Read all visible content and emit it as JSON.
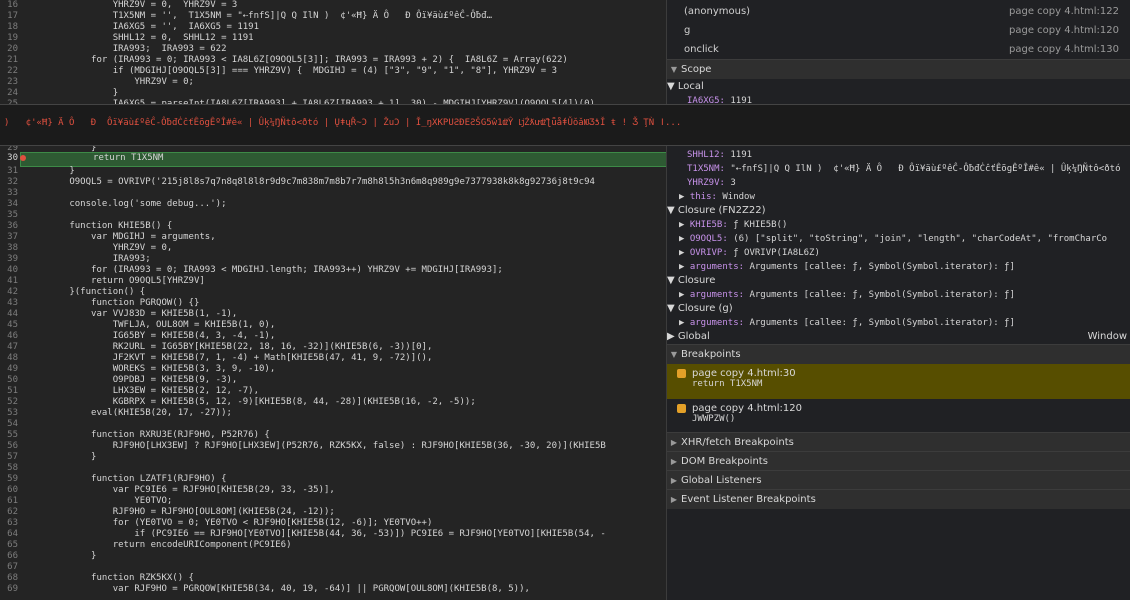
{
  "code_top": [
    {
      "n": "16",
      "t": "                YHRZ9V = 0,  YHRZ9V = 3"
    },
    {
      "n": "17",
      "t": "                T1X5NM = '',  T1X5NM = \"⇠fnfS]|Q Q IlN )  ¢'«Ħ} Ä Ô   Đ Ôï¥äù£ºêĈ-Ôƀđ…"
    },
    {
      "n": "18",
      "t": "                IA6XG5 = '',  IA6XG5 = 1191"
    },
    {
      "n": "19",
      "t": "                SHHL12 = 0,  SHHL12 = 1191"
    },
    {
      "n": "20",
      "t": "                IRA993;  IRA993 = 622"
    },
    {
      "n": "21",
      "t": "            for (IRA993 = 0; IRA993 < IA8L6Z[O9OQL5[3]]; IRA993 = IRA993 + 2) {  IA8L6Z = Array(622)"
    },
    {
      "n": "22",
      "t": "                if (MDGIHJ[O9OQL5[3]] === YHRZ9V) {  MDGIHJ = (4) [\"3\", \"9\", \"1\", \"8\"], YHRZ9V = 3"
    },
    {
      "n": "23",
      "t": "                    YHRZ9V = 0;"
    },
    {
      "n": "24",
      "t": "                }"
    },
    {
      "n": "25",
      "t": "                IA6XG5 = parseInt(IA8L6Z[IRA993] + IA8L6Z[IRA993 + 1], 30) - MDGIHJ[YHRZ9V](O9OQL5[4])(0)"
    }
  ],
  "code_mid": [
    {
      "n": "29",
      "t": "            }"
    }
  ],
  "highlight": {
    "n": "30",
    "t": "            return T1X5NM"
  },
  "code_bottom": [
    {
      "n": "31",
      "t": "        }"
    },
    {
      "n": "32",
      "t": "        O9OQL5 = OVRIVP('215j8l8s7q7n8q8l8l8r9d9c7m838m7m8b7r7m8h8l5h3n6m8q989g9e7377938k8k8g92736j8t9c94"
    },
    {
      "n": "33",
      "t": ""
    },
    {
      "n": "34",
      "t": "        console.log('some debug...');"
    },
    {
      "n": "35",
      "t": ""
    },
    {
      "n": "36",
      "t": "        function KHIE5B() {"
    },
    {
      "n": "37",
      "t": "            var MDGIHJ = arguments,"
    },
    {
      "n": "38",
      "t": "                YHRZ9V = 0,"
    },
    {
      "n": "39",
      "t": "                IRA993;"
    },
    {
      "n": "40",
      "t": "            for (IRA993 = 0; IRA993 < MDGIHJ.length; IRA993++) YHRZ9V += MDGIHJ[IRA993];"
    },
    {
      "n": "41",
      "t": "            return O9OQL5[YHRZ9V]"
    },
    {
      "n": "42",
      "t": "        }(function() {"
    },
    {
      "n": "43",
      "t": "            function PGRQOW() {}"
    },
    {
      "n": "44",
      "t": "            var VVJ83D = KHIE5B(1, -1),"
    },
    {
      "n": "45",
      "t": "                TWFLJA, OUL8OM = KHIE5B(1, 0),"
    },
    {
      "n": "46",
      "t": "                IG65BY = KHIE5B(4, 3, -4, -1),"
    },
    {
      "n": "47",
      "t": "                RK2URL = IG65BY[KHIE5B(22, 18, 16, -32)](KHIE5B(6, -3))[0],"
    },
    {
      "n": "48",
      "t": "                JF2KVT = KHIE5B(7, 1, -4) + Math[KHIE5B(47, 41, 9, -72)](),"
    },
    {
      "n": "49",
      "t": "                WOREKS = KHIE5B(3, 3, 9, -10),"
    },
    {
      "n": "50",
      "t": "                O9PDBJ = KHIE5B(9, -3),"
    },
    {
      "n": "51",
      "t": "                LHX3EW = KHIE5B(2, 12, -7),"
    },
    {
      "n": "52",
      "t": "                KGBRPX = KHIE5B(5, 12, -9)[KHIE5B(8, 44, -28)](KHIE5B(16, -2, -5));"
    },
    {
      "n": "53",
      "t": "            eval(KHIE5B(20, 17, -27));"
    },
    {
      "n": "54",
      "t": ""
    },
    {
      "n": "55",
      "t": "            function RXRU3E(RJF9HO, P52R76) {"
    },
    {
      "n": "56",
      "t": "                RJF9HO[LHX3EW] ? RJF9HO[LHX3EW](P52R76, RZK5KX, false) : RJF9HO[KHIE5B(36, -30, 20)](KHIE5B"
    },
    {
      "n": "57",
      "t": "            }"
    },
    {
      "n": "58",
      "t": ""
    },
    {
      "n": "59",
      "t": "            function LZATF1(RJF9HO) {"
    },
    {
      "n": "60",
      "t": "                var PC9IE6 = RJF9HO[KHIE5B(29, 33, -35)],"
    },
    {
      "n": "61",
      "t": "                    YE0TVO;"
    },
    {
      "n": "62",
      "t": "                RJF9HO = RJF9HO[OUL8OM](KHIE5B(24, -12));"
    },
    {
      "n": "63",
      "t": "                for (YE0TVO = 0; YE0TVO < RJF9HO[KHIE5B(12, -6)]; YE0TVO++)"
    },
    {
      "n": "64",
      "t": "                    if (PC9IE6 == RJF9HO[YE0TVO][KHIE5B(44, 36, -53)]) PC9IE6 = RJF9HO[YE0TVO][KHIE5B(54, -"
    },
    {
      "n": "65",
      "t": "                return encodeURIComponent(PC9IE6)"
    },
    {
      "n": "66",
      "t": "            }"
    },
    {
      "n": "67",
      "t": ""
    },
    {
      "n": "68",
      "t": "            function RZK5KX() {"
    },
    {
      "n": "69",
      "t": "                var RJF9HO = PGRQOW[KHIE5B(34, 40, 19, -64)] || PGRQOW[OUL8OM](KHIE5B(8, 5)),"
    }
  ],
  "tooltip_text": ")   ¢'«Ħ} Ä Ô   Đ  Ôï¥äù£ºêĈ-ÔƀđĊĉťÊõgÊºÎ#ê« | Ûķ¼ŊÑtô<ðtó | ŲǂųŘ~Ͻ | ŽuϽ | Ĭ_ŋXKPUƧÐEƧŠG5ŵ1ǆŶ ǈŹƛưǆƪǖǻǂǓǒǎǊƷƾǏ ŧ ǃ Ǯ ŢǸ ǀ...",
  "call_stack": [
    {
      "name": "(anonymous)",
      "loc": "page copy 4.html:122"
    },
    {
      "name": "g",
      "loc": "page copy 4.html:120"
    },
    {
      "name": "onclick",
      "loc": "page copy 4.html:130"
    }
  ],
  "scope_title": "Scope",
  "local_title": "Local",
  "local_vars": [
    {
      "k": "IA6XG5:",
      "v": " 1191"
    },
    {
      "k": "SHHL12:",
      "v": " 1191"
    },
    {
      "k": "T1X5NM:",
      "v": " \"⇠fnfS]|Q Q IlN )  ¢'«Ħ} Ä Ô   Đ Ôï¥äù£ºêĈ-ÔƀđĊĉťÊõgÊºÎ#ê« | Ûķ¼ŊÑtô<ðtó"
    },
    {
      "k": "YHRZ9V:",
      "v": " 3"
    },
    {
      "k": "this:",
      "v": " Window"
    }
  ],
  "closure1_title": "Closure (FN2Z22)",
  "closure1_vars": [
    {
      "k": "KHIE5B:",
      "v": " ƒ KHIE5B()"
    },
    {
      "k": "O9OQL5:",
      "v": " (6) [\"split\", \"toString\", \"join\", \"length\", \"charCodeAt\", \"fromCharCo"
    },
    {
      "k": "OVRIVP:",
      "v": " ƒ OVRIVP(IA8L6Z)"
    },
    {
      "k": "arguments:",
      "v": " Arguments [callee: ƒ, Symbol(Symbol.iterator): ƒ]"
    }
  ],
  "closure2_title": "Closure",
  "closure2_vars": [
    {
      "k": "arguments:",
      "v": " Arguments [callee: ƒ, Symbol(Symbol.iterator): ƒ]"
    }
  ],
  "closure3_title": "Closure (g)",
  "closure3_vars": [
    {
      "k": "arguments:",
      "v": " Arguments [callee: ƒ, Symbol(Symbol.iterator): ƒ]"
    }
  ],
  "global_title": "Global",
  "global_value": "Window",
  "breakpoints_title": "Breakpoints",
  "breakpoints": [
    {
      "file": "page copy 4.html:30",
      "code": "return T1X5NM"
    },
    {
      "file": "page copy 4.html:120",
      "code": "JWWPZW()"
    }
  ],
  "sections": [
    {
      "label": "XHR/fetch Breakpoints"
    },
    {
      "label": "DOM Breakpoints"
    },
    {
      "label": "Global Listeners"
    },
    {
      "label": "Event Listener Breakpoints"
    }
  ],
  "colors": {
    "highlight_line": "#2e5a33",
    "breakpoint_active_bg": "#574e00",
    "tooltip_text": "#e0503f"
  }
}
